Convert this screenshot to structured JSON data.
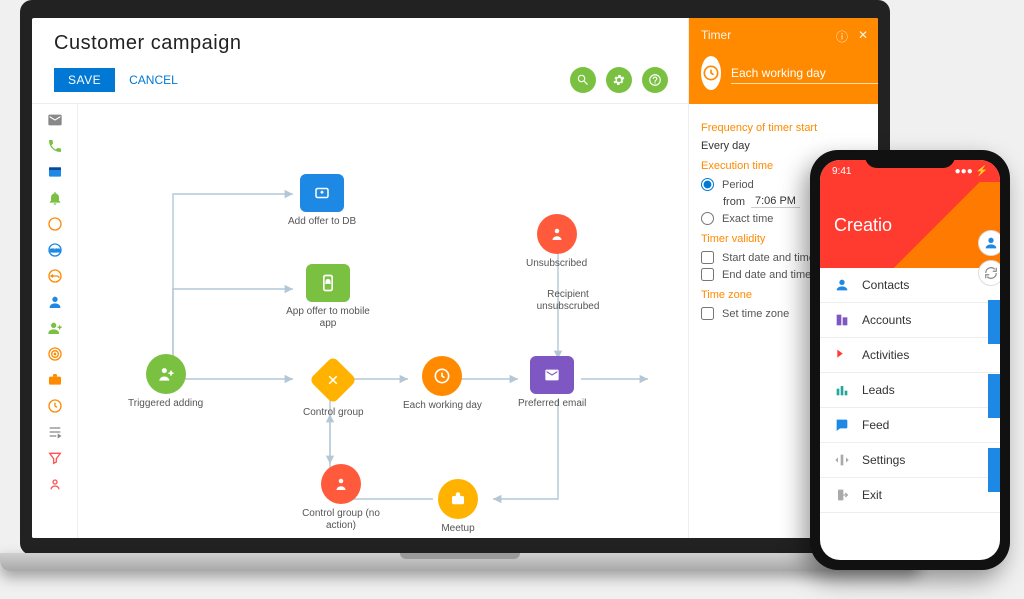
{
  "header": {
    "title": "Customer campaign",
    "save": "SAVE",
    "cancel": "CANCEL"
  },
  "panel": {
    "title": "Timer",
    "name": "Each working day",
    "freq_title": "Frequency of timer start",
    "freq_value": "Every day",
    "exec_title": "Execution time",
    "opt_period": "Period",
    "from_label": "from",
    "from_value": "7:06 PM",
    "opt_exact": "Exact time",
    "validity_title": "Timer validity",
    "chk_start": "Start date and time",
    "chk_end": "End date and time",
    "tz_title": "Time zone",
    "chk_tz": "Set time zone"
  },
  "nodes": {
    "triggered": "Triggered adding",
    "add_db": "Add offer to DB",
    "app_offer": "App offer to mobile app",
    "control": "Control group",
    "control_no": "Control group (no action)",
    "each_day": "Each working day",
    "preferred": "Preferred email",
    "unsub": "Unsubscribed",
    "recip_unsub": "Recipient unsubscrubed",
    "meetup": "Meetup"
  },
  "mobile": {
    "time": "9:41",
    "brand": "Creatio",
    "items": [
      "Contacts",
      "Accounts",
      "Activities",
      "Leads",
      "Feed",
      "Settings",
      "Exit"
    ]
  }
}
